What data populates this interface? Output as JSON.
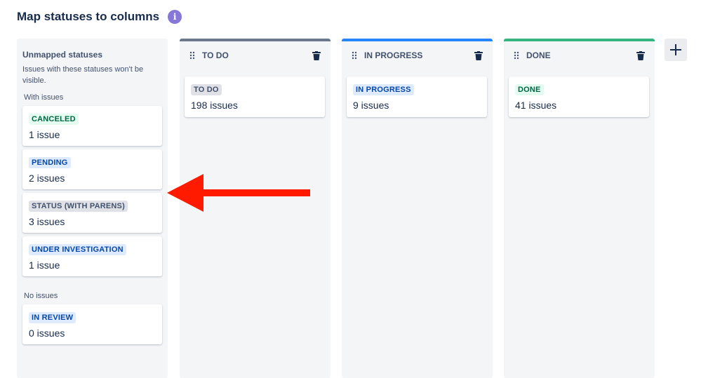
{
  "page_title": "Map statuses to columns",
  "info_icon_glyph": "i",
  "unmapped": {
    "title": "Unmapped statuses",
    "description": "Issues with these statuses won't be visible.",
    "with_issues_label": "With issues",
    "no_issues_label": "No issues",
    "with_issues": [
      {
        "status": "CANCELED",
        "count": "1 issue",
        "color": "green"
      },
      {
        "status": "PENDING",
        "count": "2 issues",
        "color": "blue"
      },
      {
        "status": "STATUS (WITH PARENS)",
        "count": "3 issues",
        "color": "grey"
      },
      {
        "status": "UNDER INVESTIGATION",
        "count": "1 issue",
        "color": "blue"
      }
    ],
    "no_issues": [
      {
        "status": "IN REVIEW",
        "count": "0 issues",
        "color": "blue"
      }
    ]
  },
  "columns": [
    {
      "name": "TO DO",
      "accent": "#6b778c",
      "card": {
        "status": "TO DO",
        "count": "198 issues",
        "color": "grey"
      }
    },
    {
      "name": "IN PROGRESS",
      "accent": "#2684ff",
      "card": {
        "status": "IN PROGRESS",
        "count": "9 issues",
        "color": "blue"
      }
    },
    {
      "name": "DONE",
      "accent": "#36b37e",
      "card": {
        "status": "DONE",
        "count": "41 issues",
        "color": "green"
      }
    }
  ],
  "colors": {
    "arrow": "#ff1a00",
    "info": "#8777d9"
  },
  "icons": [
    "info-icon",
    "drag-handle-icon",
    "trash-icon",
    "plus-icon",
    "arrow-left-icon"
  ]
}
